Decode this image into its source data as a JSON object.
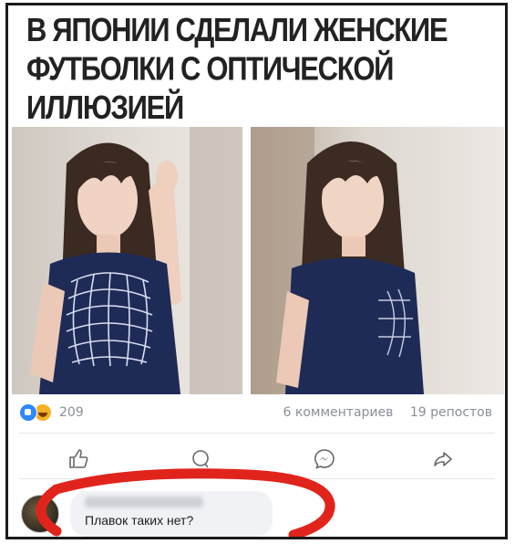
{
  "post": {
    "headline": "В Японии сделали женские футболки с оптической иллюзией"
  },
  "stats": {
    "reaction_count": "209",
    "comments": "6 комментариев",
    "reposts": "19 репостов"
  },
  "actions": {
    "icons": [
      "like-icon",
      "comment-icon",
      "messenger-icon",
      "share-icon"
    ]
  },
  "comment": {
    "text": "Плавок таких нет?"
  },
  "colors": {
    "like_blue": "#2d88ff",
    "haha_yellow": "#f7b125",
    "annotation_red": "#e0241b",
    "shirt_navy": "#1f2b57"
  }
}
